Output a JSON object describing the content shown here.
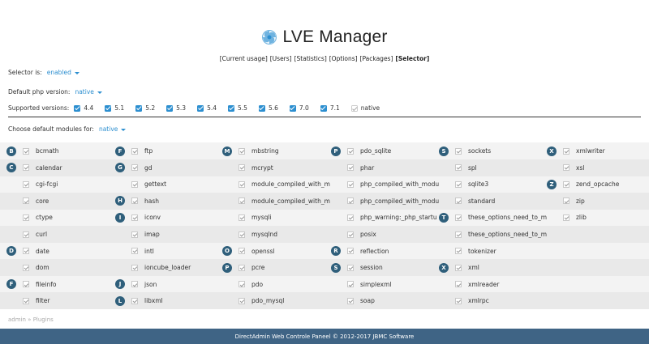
{
  "header": {
    "title": "LVE Manager",
    "nav": [
      {
        "label": "[Current usage]",
        "active": false
      },
      {
        "label": "[Users]",
        "active": false
      },
      {
        "label": "[Statistics]",
        "active": false
      },
      {
        "label": "[Options]",
        "active": false
      },
      {
        "label": "[Packages]",
        "active": false
      },
      {
        "label": "[Selector]",
        "active": true
      }
    ]
  },
  "settings": {
    "selector_label": "Selector is:",
    "selector_value": "enabled",
    "default_php_label": "Default php version:",
    "default_php_value": "native",
    "supported_label": "Supported versions:",
    "versions": [
      {
        "label": "4.4",
        "checked": true
      },
      {
        "label": "5.1",
        "checked": true
      },
      {
        "label": "5.2",
        "checked": true
      },
      {
        "label": "5.3",
        "checked": true
      },
      {
        "label": "5.4",
        "checked": true
      },
      {
        "label": "5.5",
        "checked": true
      },
      {
        "label": "5.6",
        "checked": true
      },
      {
        "label": "7.0",
        "checked": true
      },
      {
        "label": "7.1",
        "checked": true
      },
      {
        "label": "native",
        "checked": false
      }
    ],
    "modules_label": "Choose default modules for:",
    "modules_value": "native"
  },
  "modules": [
    [
      {
        "letter": "B",
        "name": "bcmath"
      },
      {
        "letter": "C",
        "name": "calendar"
      },
      {
        "letter": "",
        "name": "cgi-fcgi"
      },
      {
        "letter": "",
        "name": "core"
      },
      {
        "letter": "",
        "name": "ctype"
      },
      {
        "letter": "",
        "name": "curl"
      },
      {
        "letter": "D",
        "name": "date"
      },
      {
        "letter": "",
        "name": "dom"
      },
      {
        "letter": "F",
        "name": "fileinfo"
      },
      {
        "letter": "",
        "name": "filter"
      }
    ],
    [
      {
        "letter": "F",
        "name": "ftp"
      },
      {
        "letter": "G",
        "name": "gd"
      },
      {
        "letter": "",
        "name": "gettext"
      },
      {
        "letter": "H",
        "name": "hash"
      },
      {
        "letter": "I",
        "name": "iconv"
      },
      {
        "letter": "",
        "name": "imap"
      },
      {
        "letter": "",
        "name": "intl"
      },
      {
        "letter": "",
        "name": "ioncube_loader"
      },
      {
        "letter": "J",
        "name": "json"
      },
      {
        "letter": "L",
        "name": "libxml"
      }
    ],
    [
      {
        "letter": "M",
        "name": "mbstring"
      },
      {
        "letter": "",
        "name": "mcrypt"
      },
      {
        "letter": "",
        "name": "module_compiled_with_m"
      },
      {
        "letter": "",
        "name": "module_compiled_with_m"
      },
      {
        "letter": "",
        "name": "mysqli"
      },
      {
        "letter": "",
        "name": "mysqlnd"
      },
      {
        "letter": "O",
        "name": "openssl"
      },
      {
        "letter": "P",
        "name": "pcre"
      },
      {
        "letter": "",
        "name": "pdo"
      },
      {
        "letter": "",
        "name": "pdo_mysql"
      }
    ],
    [
      {
        "letter": "P",
        "name": "pdo_sqlite"
      },
      {
        "letter": "",
        "name": "phar"
      },
      {
        "letter": "",
        "name": "php_compiled_with_modu"
      },
      {
        "letter": "",
        "name": "php_compiled_with_modu"
      },
      {
        "letter": "",
        "name": "php_warning:_php_startu"
      },
      {
        "letter": "",
        "name": "posix"
      },
      {
        "letter": "R",
        "name": "reflection"
      },
      {
        "letter": "S",
        "name": "session"
      },
      {
        "letter": "",
        "name": "simplexml"
      },
      {
        "letter": "",
        "name": "soap"
      }
    ],
    [
      {
        "letter": "S",
        "name": "sockets"
      },
      {
        "letter": "",
        "name": "spl"
      },
      {
        "letter": "",
        "name": "sqlite3"
      },
      {
        "letter": "",
        "name": "standard"
      },
      {
        "letter": "T",
        "name": "these_options_need_to_m"
      },
      {
        "letter": "",
        "name": "these_options_need_to_m"
      },
      {
        "letter": "",
        "name": "tokenizer"
      },
      {
        "letter": "X",
        "name": "xml"
      },
      {
        "letter": "",
        "name": "xmlreader"
      },
      {
        "letter": "",
        "name": "xmlrpc"
      }
    ],
    [
      {
        "letter": "X",
        "name": "xmlwriter"
      },
      {
        "letter": "",
        "name": "xsl"
      },
      {
        "letter": "Z",
        "name": "zend_opcache"
      },
      {
        "letter": "",
        "name": "zip"
      },
      {
        "letter": "",
        "name": "zlib"
      }
    ]
  ],
  "breadcrumb": {
    "root": "admin",
    "separator": "»",
    "current": "Plugins"
  },
  "footer": {
    "text": "DirectAdmin Web Controle Paneel © 2012-2017 JBMC Software"
  },
  "colors": {
    "accent": "#2d8fd0",
    "badge": "#2f5f7b",
    "footer": "#3f6485"
  }
}
